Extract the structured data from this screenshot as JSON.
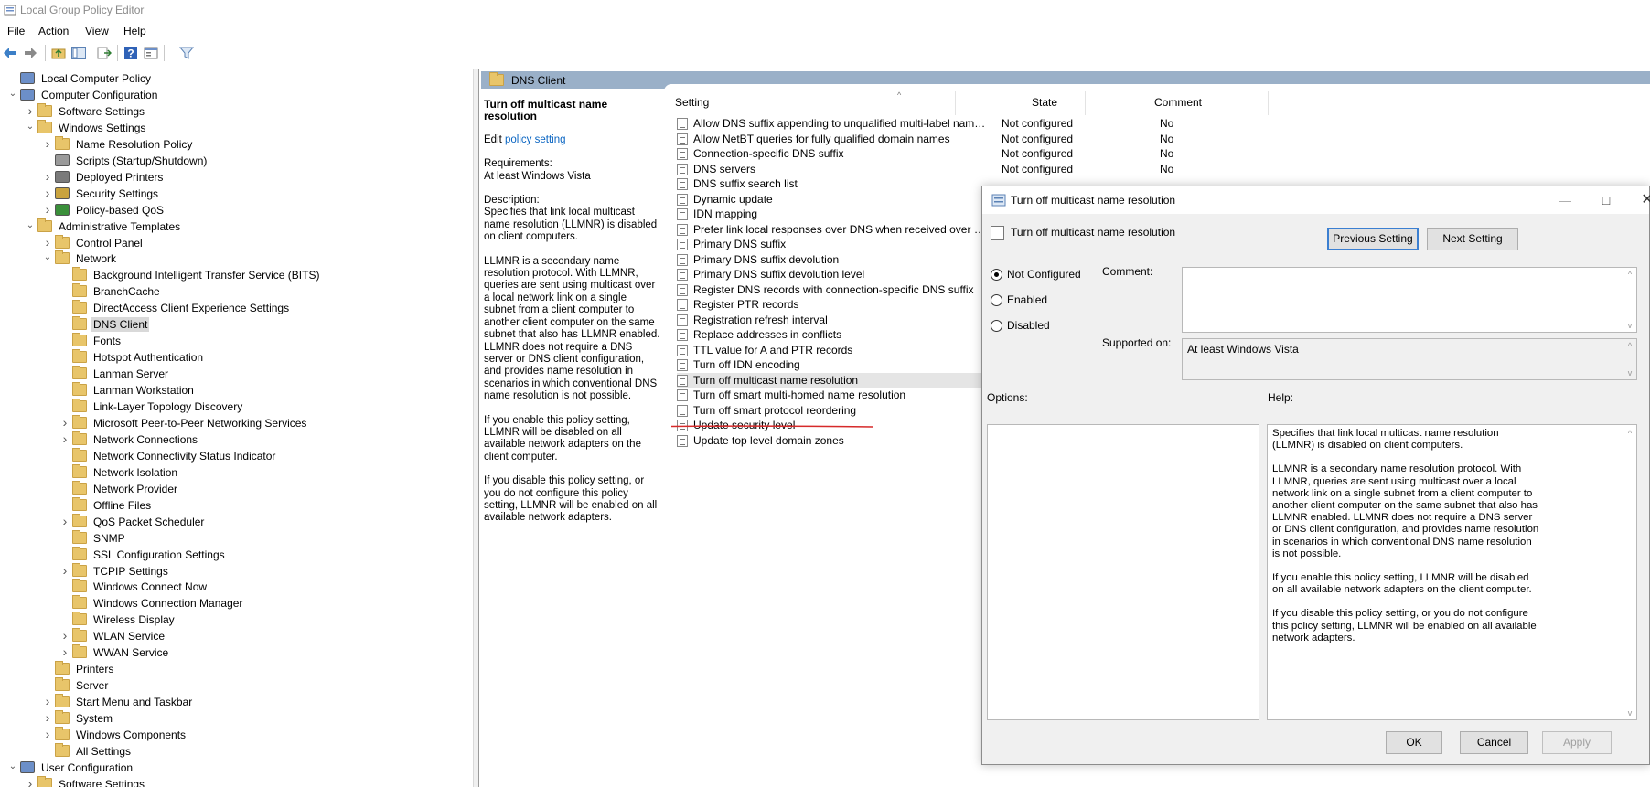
{
  "window": {
    "title": "Local Group Policy Editor"
  },
  "menu": [
    "File",
    "Action",
    "View",
    "Help"
  ],
  "tree": [
    {
      "label": "Local Computer Policy",
      "chev": ""
    },
    {
      "label": "Computer Configuration",
      "chev": "v"
    },
    {
      "label": "Software Settings",
      "chev": ">"
    },
    {
      "label": "Windows Settings",
      "chev": "v"
    },
    {
      "label": "Name Resolution Policy",
      "chev": ">"
    },
    {
      "label": "Scripts (Startup/Shutdown)",
      "chev": ""
    },
    {
      "label": "Deployed Printers",
      "chev": ">"
    },
    {
      "label": "Security Settings",
      "chev": ">"
    },
    {
      "label": "Policy-based QoS",
      "chev": ">"
    },
    {
      "label": "Administrative Templates",
      "chev": "v"
    },
    {
      "label": "Control Panel",
      "chev": ">"
    },
    {
      "label": "Network",
      "chev": "v"
    },
    {
      "label": "Background Intelligent Transfer Service (BITS)",
      "chev": ""
    },
    {
      "label": "BranchCache",
      "chev": ""
    },
    {
      "label": "DirectAccess Client Experience Settings",
      "chev": ""
    },
    {
      "label": "DNS Client",
      "chev": "",
      "selected": true
    },
    {
      "label": "Fonts",
      "chev": ""
    },
    {
      "label": "Hotspot Authentication",
      "chev": ""
    },
    {
      "label": "Lanman Server",
      "chev": ""
    },
    {
      "label": "Lanman Workstation",
      "chev": ""
    },
    {
      "label": "Link-Layer Topology Discovery",
      "chev": ""
    },
    {
      "label": "Microsoft Peer-to-Peer Networking Services",
      "chev": ">"
    },
    {
      "label": "Network Connections",
      "chev": ">"
    },
    {
      "label": "Network Connectivity Status Indicator",
      "chev": ""
    },
    {
      "label": "Network Isolation",
      "chev": ""
    },
    {
      "label": "Network Provider",
      "chev": ""
    },
    {
      "label": "Offline Files",
      "chev": ""
    },
    {
      "label": "QoS Packet Scheduler",
      "chev": ">"
    },
    {
      "label": "SNMP",
      "chev": ""
    },
    {
      "label": "SSL Configuration Settings",
      "chev": ""
    },
    {
      "label": "TCPIP Settings",
      "chev": ">"
    },
    {
      "label": "Windows Connect Now",
      "chev": ""
    },
    {
      "label": "Windows Connection Manager",
      "chev": ""
    },
    {
      "label": "Wireless Display",
      "chev": ""
    },
    {
      "label": "WLAN Service",
      "chev": ">"
    },
    {
      "label": "WWAN Service",
      "chev": ">"
    },
    {
      "label": "Printers",
      "chev": ""
    },
    {
      "label": "Server",
      "chev": ""
    },
    {
      "label": "Start Menu and Taskbar",
      "chev": ">"
    },
    {
      "label": "System",
      "chev": ">"
    },
    {
      "label": "Windows Components",
      "chev": ">"
    },
    {
      "label": "All Settings",
      "chev": ""
    },
    {
      "label": "User Configuration",
      "chev": "v"
    },
    {
      "label": "Software Settings",
      "chev": ">"
    }
  ],
  "right_pane": {
    "header": "DNS Client",
    "description": {
      "title": "Turn off multicast name resolution",
      "edit_prefix": "Edit ",
      "edit_link": "policy setting",
      "requirements_label": "Requirements:",
      "requirements_value": "At least Windows Vista",
      "description_label": "Description:",
      "p1": "Specifies that link local multicast name resolution (LLMNR) is disabled on client computers.",
      "p2": "LLMNR is a secondary name resolution protocol. With LLMNR, queries are sent using multicast over a local network link on a single subnet from a client computer to another client computer on the same subnet that also has LLMNR enabled. LLMNR does not require a DNS server or DNS client configuration, and provides name resolution in scenarios in which conventional DNS name resolution is not possible.",
      "p3": "If you enable this policy setting, LLMNR will be disabled on all available network adapters on the client computer.",
      "p4": "If you disable this policy setting, or you do not configure this policy setting, LLMNR will be enabled on all available network adapters."
    },
    "columns": {
      "setting": "Setting",
      "state": "State",
      "comment": "Comment"
    },
    "settings": [
      {
        "name": "Allow DNS suffix appending to unqualified multi-label name queries",
        "state": "Not configured",
        "comment": "No"
      },
      {
        "name": "Allow NetBT queries for fully qualified domain names",
        "state": "Not configured",
        "comment": "No"
      },
      {
        "name": "Connection-specific DNS suffix",
        "state": "Not configured",
        "comment": "No"
      },
      {
        "name": "DNS servers",
        "state": "Not configured",
        "comment": "No"
      },
      {
        "name": "DNS suffix search list",
        "state": "",
        "comment": ""
      },
      {
        "name": "Dynamic update",
        "state": "",
        "comment": ""
      },
      {
        "name": "IDN mapping",
        "state": "",
        "comment": ""
      },
      {
        "name": "Prefer link local responses over DNS when received over a n...",
        "state": "",
        "comment": ""
      },
      {
        "name": "Primary DNS suffix",
        "state": "",
        "comment": ""
      },
      {
        "name": "Primary DNS suffix devolution",
        "state": "",
        "comment": ""
      },
      {
        "name": "Primary DNS suffix devolution level",
        "state": "",
        "comment": ""
      },
      {
        "name": "Register DNS records with connection-specific DNS suffix",
        "state": "",
        "comment": ""
      },
      {
        "name": "Register PTR records",
        "state": "",
        "comment": ""
      },
      {
        "name": "Registration refresh interval",
        "state": "",
        "comment": ""
      },
      {
        "name": "Replace addresses in conflicts",
        "state": "",
        "comment": ""
      },
      {
        "name": "TTL value for A and PTR records",
        "state": "",
        "comment": ""
      },
      {
        "name": "Turn off IDN encoding",
        "state": "",
        "comment": ""
      },
      {
        "name": "Turn off multicast name resolution",
        "state": "",
        "comment": "",
        "selected": true
      },
      {
        "name": "Turn off smart multi-homed name resolution",
        "state": "",
        "comment": ""
      },
      {
        "name": "Turn off smart protocol reordering",
        "state": "",
        "comment": ""
      },
      {
        "name": "Update security level",
        "state": "",
        "comment": ""
      },
      {
        "name": "Update top level domain zones",
        "state": "",
        "comment": ""
      }
    ]
  },
  "dialog": {
    "title": "Turn off multicast name resolution",
    "subtitle": "Turn off multicast name resolution",
    "prev_button": "Previous Setting",
    "next_button": "Next Setting",
    "radios": [
      "Not Configured",
      "Enabled",
      "Disabled"
    ],
    "selected_radio": 0,
    "comment_label": "Comment:",
    "supported_label": "Supported on:",
    "supported_value": "At least Windows Vista",
    "options_label": "Options:",
    "help_label": "Help:",
    "help_p1": "Specifies that link local multicast name resolution (LLMNR) is disabled on client computers.",
    "help_p2": "LLMNR is a secondary name resolution protocol. With LLMNR, queries are sent using multicast over a local network link on a single subnet from a client computer to another client computer on the same subnet that also has LLMNR enabled. LLMNR does not require a DNS server or DNS client configuration, and provides name resolution in scenarios in which conventional DNS name resolution is not possible.",
    "help_p3": "If you enable this policy setting, LLMNR will be disabled on all available network adapters on the client computer.",
    "help_p4": "If you disable this policy setting, or you do not configure this policy setting, LLMNR will be enabled on all available network adapters.",
    "ok": "OK",
    "cancel": "Cancel",
    "apply": "Apply"
  },
  "colors": {
    "header_band": "#9ab0c8",
    "link": "#0a65c2",
    "annotation": "#d62a2a",
    "default_button_border": "#3b7fd1"
  }
}
